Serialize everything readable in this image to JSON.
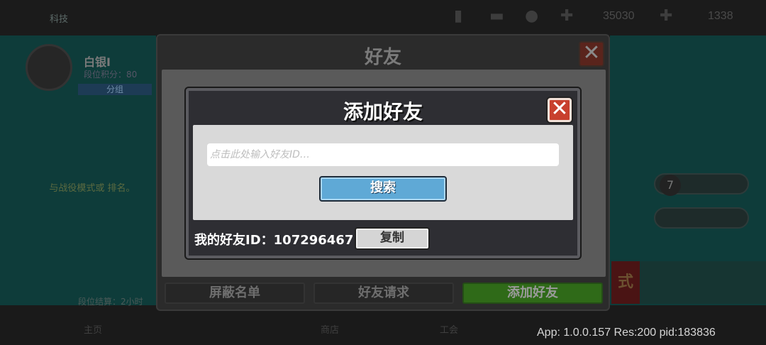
{
  "background": {
    "header_label": "科技",
    "top_numbers": [
      "35030",
      "1338"
    ],
    "rank_name": "白银I",
    "rank_points": "段位积分：80",
    "group_label": "分组",
    "left_note": "与战役模式或 排名。",
    "timer": "段位结算：2小时",
    "level": "7",
    "mode_label": "式",
    "bottom_nav": [
      "主页",
      "商店",
      "工会"
    ]
  },
  "friends_panel": {
    "title": "好友",
    "tabs": [
      {
        "label": "屏蔽名单",
        "active": false
      },
      {
        "label": "好友请求",
        "active": false
      },
      {
        "label": "添加好友",
        "active": true
      }
    ]
  },
  "add_friend_modal": {
    "title": "添加好友",
    "input": {
      "placeholder": "点击此处输入好友ID…",
      "value": ""
    },
    "search_label": "搜索",
    "my_id_label": "我的好友ID：",
    "my_id_value": "107296467",
    "copy_label": "复制"
  },
  "app_info": "App: 1.0.0.157 Res:200 pid:183836",
  "icons": {
    "close": "close-icon",
    "mail": "mail-icon",
    "chat": "chat-icon",
    "person": "person-icon",
    "plus": "plus-icon"
  },
  "colors": {
    "search_button": "#5fa9d6",
    "close_button": "#c8402e",
    "active_tab": "#2f6a18",
    "background_teal": "#0e3c3a"
  }
}
